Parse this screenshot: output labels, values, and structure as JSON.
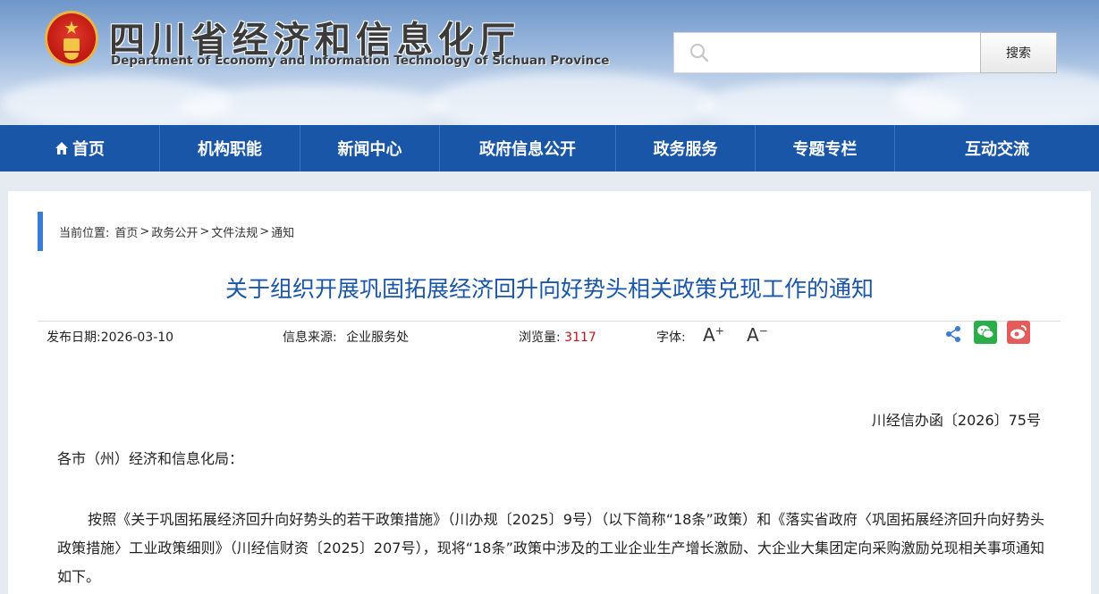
{
  "header": {
    "title": "四川省经济和信息化厅",
    "subtitle": "Department of Economy and Information Technology of Sichuan Province",
    "search": {
      "placeholder": "",
      "button_label": "搜索"
    }
  },
  "nav": {
    "items": [
      {
        "label": "首页",
        "icon": "home-icon"
      },
      {
        "label": "机构职能"
      },
      {
        "label": "新闻中心"
      },
      {
        "label": "政府信息公开"
      },
      {
        "label": "政务服务"
      },
      {
        "label": "专题专栏"
      },
      {
        "label": "互动交流"
      }
    ]
  },
  "breadcrumb": {
    "prefix": "当前位置:",
    "items": [
      "首页",
      "政务公开",
      "文件法规",
      "通知"
    ],
    "separator": ">"
  },
  "article": {
    "title": "关于组织开展巩固拓展经济回升向好势头相关政策兑现工作的通知",
    "meta": {
      "date_label": "发布日期:2026-03-10",
      "source_label": "信息来源:",
      "source_value": "企业服务处",
      "views_label": "浏览量:",
      "views_value": "3117",
      "font_label": "字体:",
      "font_larger": "A",
      "font_smaller": "A"
    },
    "doc_number": "川经信办函〔2026〕75号",
    "salutation": "各市（州）经济和信息化局：",
    "paragraph": "按照《关于巩固拓展经济回升向好势头的若干政策措施》（川办规〔2025〕9号）（以下简称“18条”政策）和《落实省政府〈巩固拓展经济回升向好势头政策措施〉工业政策细则》（川经信财资〔2025〕207号），现将“18条”政策中涉及的工业企业生产增长激励、大企业大集团定向采购激励兑现相关事项通知如下。"
  },
  "colors": {
    "nav_bg": "#1a56a8",
    "title_blue": "#1a56a8",
    "accent_red": "#c4161c",
    "breadcrumb_bar": "#3a7bd5"
  }
}
